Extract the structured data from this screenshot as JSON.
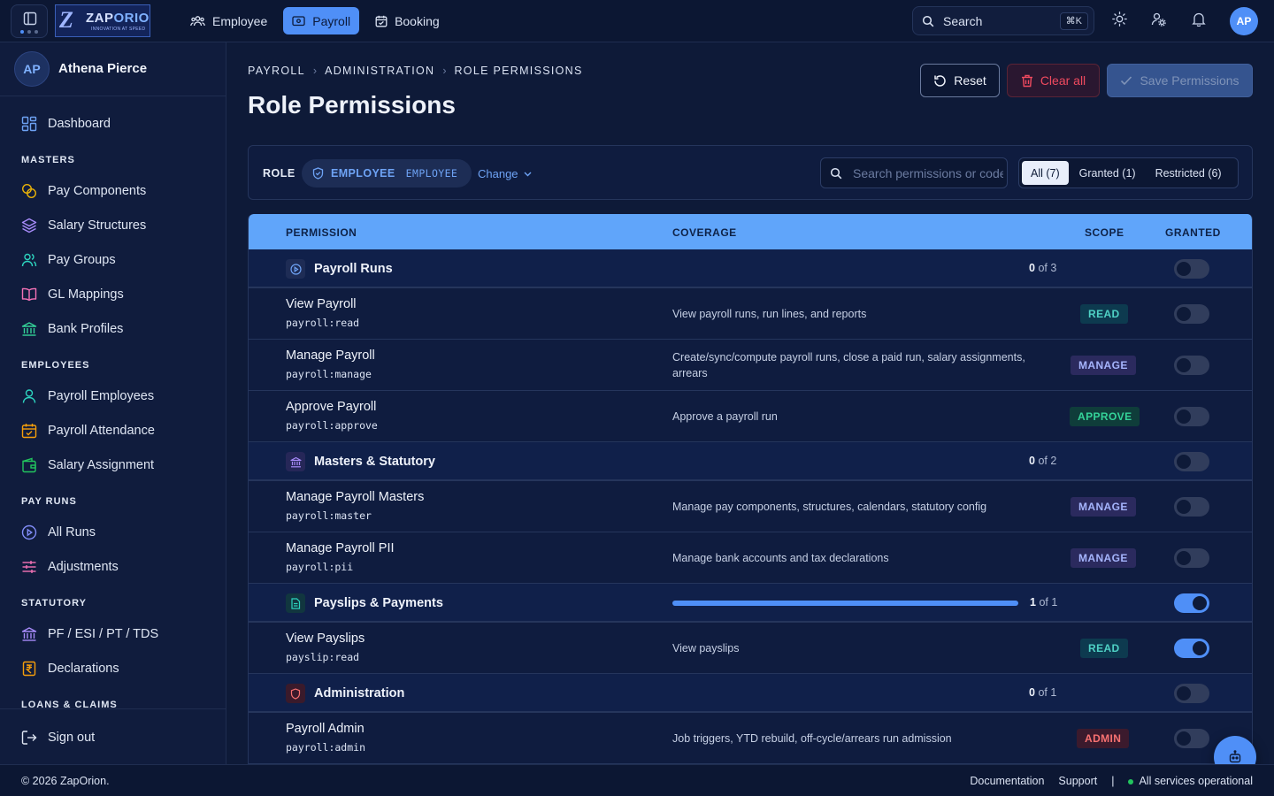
{
  "topbar": {
    "logo": {
      "brand_a": "ZAP",
      "brand_b": "ORION",
      "tagline": "INNOVATION AT SPEED"
    },
    "nav": [
      {
        "label": "Employee",
        "icon": "users-icon",
        "active": false
      },
      {
        "label": "Payroll",
        "icon": "wallet-icon",
        "active": true
      },
      {
        "label": "Booking",
        "icon": "calendar-icon",
        "active": false
      }
    ],
    "search_label": "Search",
    "search_shortcut": "⌘K",
    "avatar_initials": "AP"
  },
  "sidebar": {
    "user": {
      "initials": "AP",
      "name": "Athena Pierce"
    },
    "dashboard": "Dashboard",
    "sections": {
      "masters": "MASTERS",
      "employees": "EMPLOYEES",
      "pay_runs": "PAY RUNS",
      "statutory": "STATUTORY",
      "loans": "LOANS & CLAIMS"
    },
    "items": {
      "pay_components": "Pay Components",
      "salary_structures": "Salary Structures",
      "pay_groups": "Pay Groups",
      "gl_mappings": "GL Mappings",
      "bank_profiles": "Bank Profiles",
      "payroll_employees": "Payroll Employees",
      "payroll_attendance": "Payroll Attendance",
      "salary_assignment": "Salary Assignment",
      "all_runs": "All Runs",
      "adjustments": "Adjustments",
      "pf_esi": "PF / ESI / PT / TDS",
      "declarations": "Declarations"
    },
    "sign_out": "Sign out"
  },
  "page": {
    "breadcrumb": [
      "PAYROLL",
      "ADMINISTRATION",
      "ROLE PERMISSIONS"
    ],
    "title": "Role Permissions",
    "buttons": {
      "reset": "Reset",
      "clear": "Clear all",
      "save": "Save Permissions"
    }
  },
  "rolebar": {
    "label": "ROLE",
    "role_name": "EMPLOYEE",
    "role_code": "EMPLOYEE",
    "change": "Change",
    "search_placeholder": "Search permissions or codes",
    "filters": [
      "All (7)",
      "Granted (1)",
      "Restricted (6)"
    ],
    "active_filter": "All (7)"
  },
  "table": {
    "headers": {
      "permission": "PERMISSION",
      "coverage": "COVERAGE",
      "scope": "SCOPE",
      "granted": "GRANTED"
    },
    "groups": [
      {
        "title": "Payroll Runs",
        "icon": "play-circle-icon",
        "granted": "0",
        "of_total": "of 3",
        "progress": 0.0,
        "on": false
      },
      {
        "title": "Masters & Statutory",
        "icon": "bank-icon",
        "granted": "0",
        "of_total": "of 2",
        "progress": 0.0,
        "on": false
      },
      {
        "title": "Payslips & Payments",
        "icon": "document-icon",
        "granted": "1",
        "of_total": "of 1",
        "progress": 1.0,
        "on": true
      },
      {
        "title": "Administration",
        "icon": "shield-icon",
        "granted": "0",
        "of_total": "of 1",
        "progress": 0.0,
        "on": false
      }
    ],
    "permissions": [
      {
        "name": "View Payroll",
        "code": "payroll:read",
        "coverage": "View payroll runs, run lines, and reports",
        "scope": "READ",
        "on": false
      },
      {
        "name": "Manage Payroll",
        "code": "payroll:manage",
        "coverage": "Create/sync/compute payroll runs, close a paid run, salary assignments, arrears",
        "scope": "MANAGE",
        "on": false
      },
      {
        "name": "Approve Payroll",
        "code": "payroll:approve",
        "coverage": "Approve a payroll run",
        "scope": "APPROVE",
        "on": false
      },
      {
        "name": "Manage Payroll Masters",
        "code": "payroll:master",
        "coverage": "Manage pay components, structures, calendars, statutory config",
        "scope": "MANAGE",
        "on": false
      },
      {
        "name": "Manage Payroll PII",
        "code": "payroll:pii",
        "coverage": "Manage bank accounts and tax declarations",
        "scope": "MANAGE",
        "on": false
      },
      {
        "name": "View Payslips",
        "code": "payslip:read",
        "coverage": "View payslips",
        "scope": "READ",
        "on": true
      },
      {
        "name": "Payroll Admin",
        "code": "payroll:admin",
        "coverage": "Job triggers, YTD rebuild, off-cycle/arrears run admission",
        "scope": "ADMIN",
        "on": false
      }
    ]
  },
  "footer": {
    "copyright": "© 2026 ZapOrion.",
    "documentation": "Documentation",
    "support": "Support",
    "separator": "|",
    "status": "All services operational"
  },
  "colors": {
    "accent": "#4f8ff7",
    "background": "#0e1a38",
    "table_header": "#60a5fa",
    "danger": "#f04a5f",
    "status_ok": "#22c55e"
  }
}
